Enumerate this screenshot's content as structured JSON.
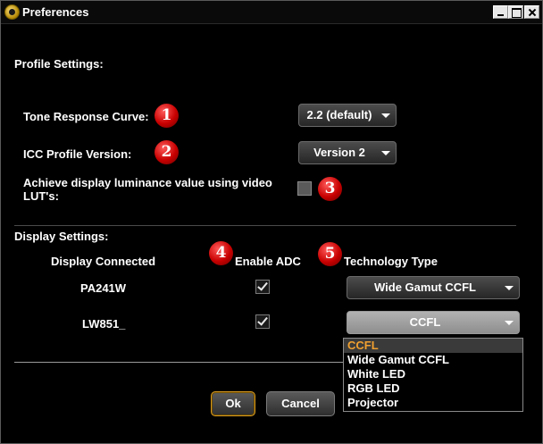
{
  "window": {
    "title": "Preferences",
    "icon": "app-emblem-icon"
  },
  "profile_section": {
    "heading": "Profile Settings:",
    "tone_label": "Tone Response Curve:",
    "tone_value": "2.2 (default)",
    "icc_label": "ICC Profile Version:",
    "icc_value": "Version 2",
    "lut_label_line1": "Achieve display luminance value using video",
    "lut_label_line2": "LUT's:",
    "lut_checked": false
  },
  "badges": [
    "1",
    "2",
    "3",
    "4",
    "5"
  ],
  "display_section": {
    "heading": "Display Settings:",
    "col_display": "Display Connected",
    "col_adc": "Enable ADC",
    "col_tech": "Technology Type",
    "rows": [
      {
        "name": "PA241W",
        "adc": true,
        "tech": "Wide Gamut CCFL"
      },
      {
        "name": "LW851_",
        "adc": true,
        "tech": "CCFL"
      }
    ]
  },
  "tech_options": [
    "CCFL",
    "Wide Gamut CCFL",
    "White LED",
    "RGB LED",
    "Projector"
  ],
  "buttons": {
    "ok": "Ok",
    "cancel": "Cancel"
  },
  "colors": {
    "badge": "#c80000",
    "selected_option": "#f0a030",
    "ok_border": "#d89a20"
  }
}
